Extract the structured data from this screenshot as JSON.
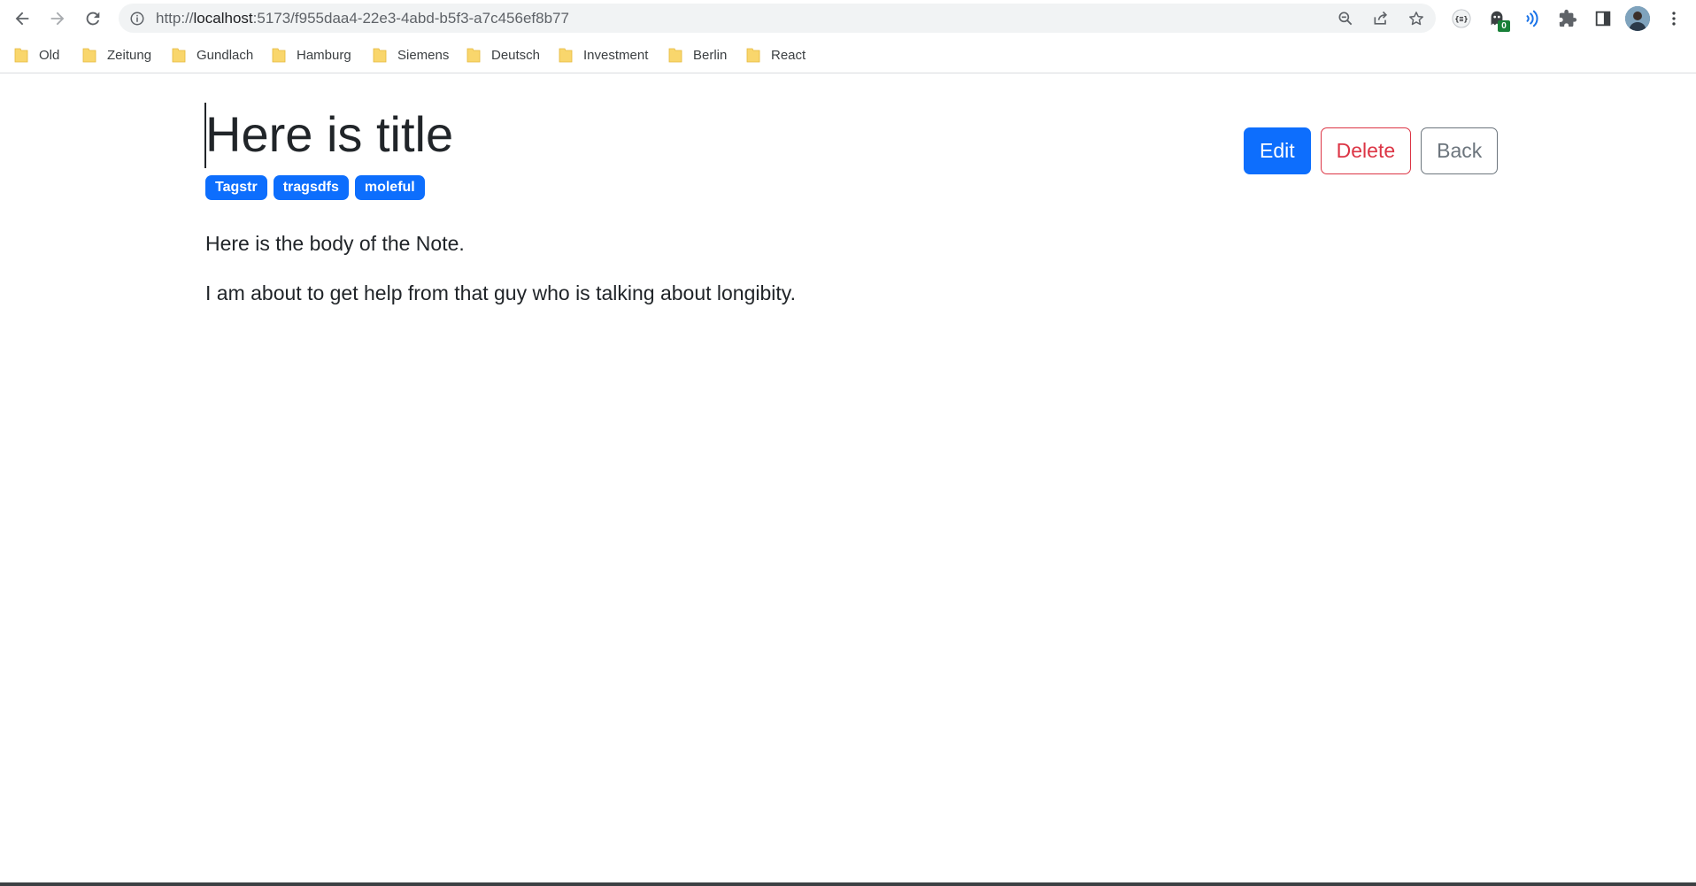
{
  "browser": {
    "url_scheme": "http://",
    "url_host": "localhost",
    "url_rest": ":5173/f955daa4-22e3-4abd-b5f3-a7c456ef8b77",
    "extension_badge": "0",
    "icons": {
      "back": "arrow-left-icon",
      "forward": "arrow-right-icon",
      "reload": "reload-icon",
      "info": "info-icon",
      "zoom": "zoom-icon",
      "share": "share-icon",
      "bookmark": "star-icon",
      "extensions": "puzzle-icon",
      "side_panel": "side-panel-icon",
      "menu": "kebab-menu-icon"
    }
  },
  "bookmarks": [
    {
      "label": "Old"
    },
    {
      "label": "Zeitung"
    },
    {
      "label": "Gundlach"
    },
    {
      "label": "Hamburg"
    },
    {
      "label": "Siemens"
    },
    {
      "label": "Deutsch"
    },
    {
      "label": "Investment"
    },
    {
      "label": "Berlin"
    },
    {
      "label": "React"
    }
  ],
  "note": {
    "title": "Here is title",
    "tags": [
      "Tagstr",
      "tragsdfs",
      "moleful"
    ],
    "body": [
      "Here is the body of the Note.",
      "I am about to get help from that guy who is talking about longibity."
    ]
  },
  "actions": {
    "edit": "Edit",
    "delete": "Delete",
    "back": "Back"
  },
  "colors": {
    "primary": "#0d6efd",
    "danger": "#dc3545",
    "secondary": "#6c757d",
    "folder": "#f9d66c"
  }
}
